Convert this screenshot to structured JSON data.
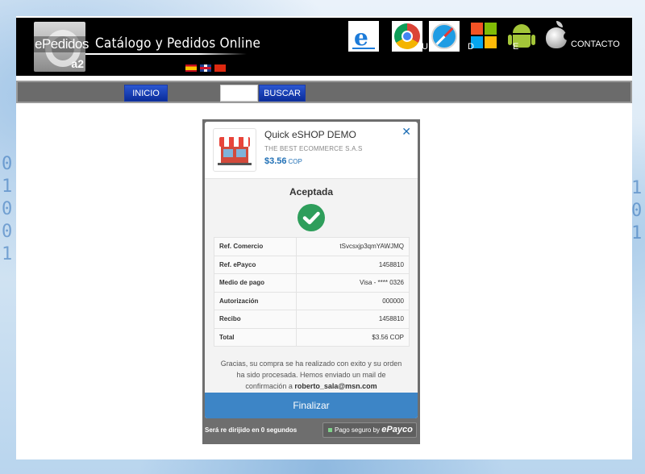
{
  "header": {
    "logo_text": "ePedidos",
    "logo_sub": "a2",
    "site_title": "Catálogo y Pedidos Online",
    "languages": [
      "es",
      "en",
      "cn"
    ],
    "nav_labels": {
      "u": "U",
      "d": "D",
      "e": "E",
      "contact": "CONTACTO"
    },
    "icons": [
      "internet-explorer-icon",
      "chrome-icon",
      "safari-icon",
      "windows-icon",
      "android-icon",
      "apple-icon"
    ]
  },
  "toolbar": {
    "inicio_label": "INICIO",
    "buscar_label": "BUSCAR",
    "search_placeholder": ""
  },
  "modal": {
    "merchant_name": "Quick eSHOP DEMO",
    "merchant_company": "THE BEST ECOMMERCE S.A.S",
    "amount": "$3.56",
    "currency": "COP",
    "close_label": "✕",
    "status": "Aceptada",
    "details": [
      {
        "label": "Ref. Comercio",
        "value": "tSvcsxjp3qmYAWJMQ"
      },
      {
        "label": "Ref. ePayco",
        "value": "1458810"
      },
      {
        "label": "Medio de pago",
        "value": "Visa - **** 0326"
      },
      {
        "label": "Autorización",
        "value": "000000"
      },
      {
        "label": "Recibo",
        "value": "1458810"
      },
      {
        "label": "Total",
        "value": "$3.56 COP"
      }
    ],
    "thanks_text": "Gracias, su compra se ha realizado con exito y su orden ha sido procesada. Hemos enviado un mail de confirmación a",
    "email": "roberto_sala@msn.com",
    "finalize_label": "Finalizar",
    "redirect_text": "Será re dirijido en 0 segundos",
    "secure_text": "Pago seguro by",
    "secure_brand": "ePayco"
  },
  "colors": {
    "accent": "#3d85c6",
    "success": "#2e9e5b",
    "nav_button": "#0a2c9a"
  }
}
